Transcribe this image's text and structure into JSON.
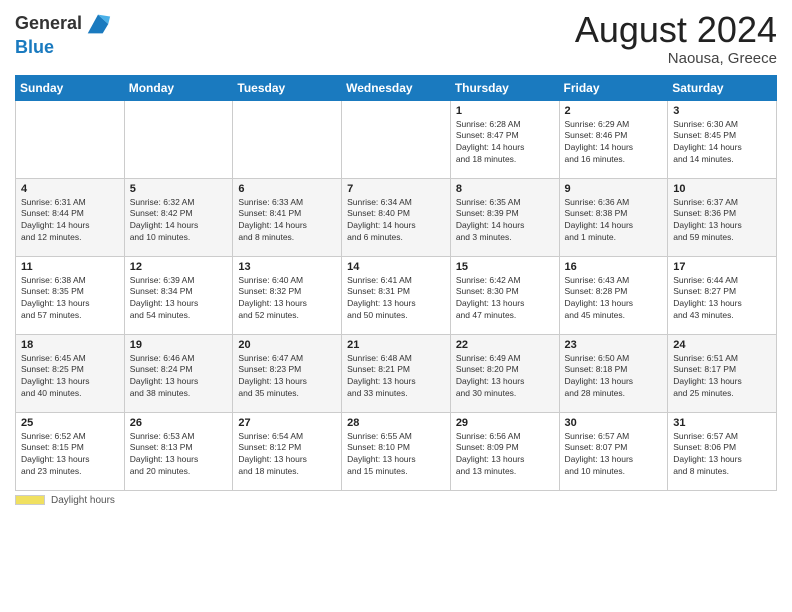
{
  "header": {
    "logo_text_general": "General",
    "logo_text_blue": "Blue",
    "month_title": "August 2024",
    "location": "Naousa, Greece"
  },
  "calendar": {
    "days_of_week": [
      "Sunday",
      "Monday",
      "Tuesday",
      "Wednesday",
      "Thursday",
      "Friday",
      "Saturday"
    ],
    "weeks": [
      [
        {
          "day": "",
          "info": ""
        },
        {
          "day": "",
          "info": ""
        },
        {
          "day": "",
          "info": ""
        },
        {
          "day": "",
          "info": ""
        },
        {
          "day": "1",
          "info": "Sunrise: 6:28 AM\nSunset: 8:47 PM\nDaylight: 14 hours\nand 18 minutes."
        },
        {
          "day": "2",
          "info": "Sunrise: 6:29 AM\nSunset: 8:46 PM\nDaylight: 14 hours\nand 16 minutes."
        },
        {
          "day": "3",
          "info": "Sunrise: 6:30 AM\nSunset: 8:45 PM\nDaylight: 14 hours\nand 14 minutes."
        }
      ],
      [
        {
          "day": "4",
          "info": "Sunrise: 6:31 AM\nSunset: 8:44 PM\nDaylight: 14 hours\nand 12 minutes."
        },
        {
          "day": "5",
          "info": "Sunrise: 6:32 AM\nSunset: 8:42 PM\nDaylight: 14 hours\nand 10 minutes."
        },
        {
          "day": "6",
          "info": "Sunrise: 6:33 AM\nSunset: 8:41 PM\nDaylight: 14 hours\nand 8 minutes."
        },
        {
          "day": "7",
          "info": "Sunrise: 6:34 AM\nSunset: 8:40 PM\nDaylight: 14 hours\nand 6 minutes."
        },
        {
          "day": "8",
          "info": "Sunrise: 6:35 AM\nSunset: 8:39 PM\nDaylight: 14 hours\nand 3 minutes."
        },
        {
          "day": "9",
          "info": "Sunrise: 6:36 AM\nSunset: 8:38 PM\nDaylight: 14 hours\nand 1 minute."
        },
        {
          "day": "10",
          "info": "Sunrise: 6:37 AM\nSunset: 8:36 PM\nDaylight: 13 hours\nand 59 minutes."
        }
      ],
      [
        {
          "day": "11",
          "info": "Sunrise: 6:38 AM\nSunset: 8:35 PM\nDaylight: 13 hours\nand 57 minutes."
        },
        {
          "day": "12",
          "info": "Sunrise: 6:39 AM\nSunset: 8:34 PM\nDaylight: 13 hours\nand 54 minutes."
        },
        {
          "day": "13",
          "info": "Sunrise: 6:40 AM\nSunset: 8:32 PM\nDaylight: 13 hours\nand 52 minutes."
        },
        {
          "day": "14",
          "info": "Sunrise: 6:41 AM\nSunset: 8:31 PM\nDaylight: 13 hours\nand 50 minutes."
        },
        {
          "day": "15",
          "info": "Sunrise: 6:42 AM\nSunset: 8:30 PM\nDaylight: 13 hours\nand 47 minutes."
        },
        {
          "day": "16",
          "info": "Sunrise: 6:43 AM\nSunset: 8:28 PM\nDaylight: 13 hours\nand 45 minutes."
        },
        {
          "day": "17",
          "info": "Sunrise: 6:44 AM\nSunset: 8:27 PM\nDaylight: 13 hours\nand 43 minutes."
        }
      ],
      [
        {
          "day": "18",
          "info": "Sunrise: 6:45 AM\nSunset: 8:25 PM\nDaylight: 13 hours\nand 40 minutes."
        },
        {
          "day": "19",
          "info": "Sunrise: 6:46 AM\nSunset: 8:24 PM\nDaylight: 13 hours\nand 38 minutes."
        },
        {
          "day": "20",
          "info": "Sunrise: 6:47 AM\nSunset: 8:23 PM\nDaylight: 13 hours\nand 35 minutes."
        },
        {
          "day": "21",
          "info": "Sunrise: 6:48 AM\nSunset: 8:21 PM\nDaylight: 13 hours\nand 33 minutes."
        },
        {
          "day": "22",
          "info": "Sunrise: 6:49 AM\nSunset: 8:20 PM\nDaylight: 13 hours\nand 30 minutes."
        },
        {
          "day": "23",
          "info": "Sunrise: 6:50 AM\nSunset: 8:18 PM\nDaylight: 13 hours\nand 28 minutes."
        },
        {
          "day": "24",
          "info": "Sunrise: 6:51 AM\nSunset: 8:17 PM\nDaylight: 13 hours\nand 25 minutes."
        }
      ],
      [
        {
          "day": "25",
          "info": "Sunrise: 6:52 AM\nSunset: 8:15 PM\nDaylight: 13 hours\nand 23 minutes."
        },
        {
          "day": "26",
          "info": "Sunrise: 6:53 AM\nSunset: 8:13 PM\nDaylight: 13 hours\nand 20 minutes."
        },
        {
          "day": "27",
          "info": "Sunrise: 6:54 AM\nSunset: 8:12 PM\nDaylight: 13 hours\nand 18 minutes."
        },
        {
          "day": "28",
          "info": "Sunrise: 6:55 AM\nSunset: 8:10 PM\nDaylight: 13 hours\nand 15 minutes."
        },
        {
          "day": "29",
          "info": "Sunrise: 6:56 AM\nSunset: 8:09 PM\nDaylight: 13 hours\nand 13 minutes."
        },
        {
          "day": "30",
          "info": "Sunrise: 6:57 AM\nSunset: 8:07 PM\nDaylight: 13 hours\nand 10 minutes."
        },
        {
          "day": "31",
          "info": "Sunrise: 6:57 AM\nSunset: 8:06 PM\nDaylight: 13 hours\nand 8 minutes."
        }
      ]
    ]
  },
  "footer": {
    "label": "Daylight hours"
  }
}
